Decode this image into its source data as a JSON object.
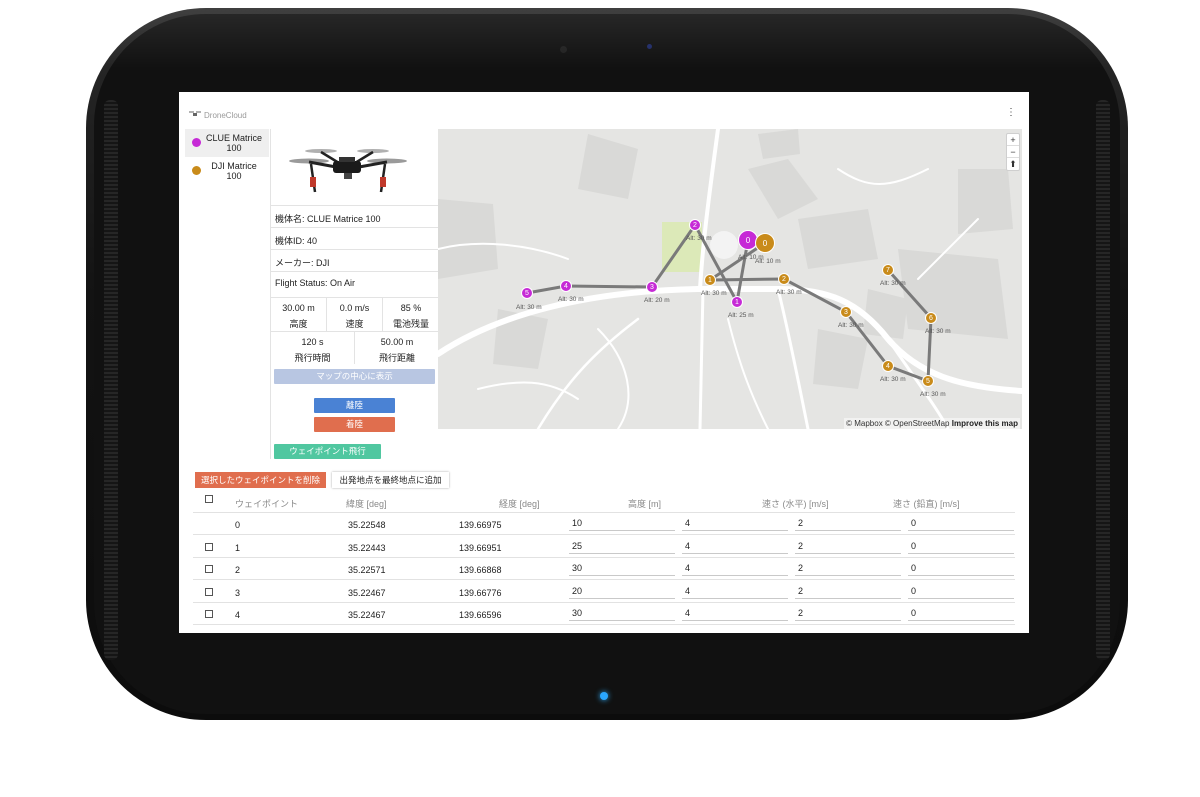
{
  "app": {
    "title": "DroneCloud"
  },
  "drones": [
    {
      "name": "CLUE Matrice 100",
      "color": "#c62ad6",
      "active": true
    },
    {
      "name": "DJI Matrice 100",
      "color": "#c98b1a",
      "active": false
    }
  ],
  "detail": {
    "model_label": "機体名: CLUE Matrice 100",
    "id_label": "機体ID: 40",
    "maker_label": "メーカー: DJI",
    "status_label": "Flight Status: On Air",
    "stats": {
      "altitude": {
        "value": "30.00 m",
        "label": "高度"
      },
      "speed": {
        "value": "0.0 m/s",
        "label": "速度"
      },
      "battery": {
        "value": "85 %",
        "label": "電池残量"
      },
      "flight_time": {
        "value": "120 s",
        "label": "飛行時間"
      },
      "flight_distance": {
        "value": "50.00 m",
        "label": "飛行距離"
      }
    },
    "buttons": {
      "center_map": "マップの中心に表示",
      "takeoff": "離陸",
      "land": "着陸",
      "waypoint_flight": "ウェイポイント飛行"
    }
  },
  "map": {
    "zoom_in": "+",
    "zoom_out": "−",
    "compass": "⬆",
    "attribution_text": "© Mapbox © OpenStreetMap",
    "attribution_link": "Improve this map",
    "route_purple": {
      "color": "#c62ad6",
      "markers": [
        {
          "n": "0",
          "alt": "Alt: 10 m"
        },
        {
          "n": "1",
          "alt": "Alt: 25 m"
        },
        {
          "n": "2",
          "alt": "Alt: 30 m"
        },
        {
          "n": "3",
          "alt": "Alt: 20 m"
        },
        {
          "n": "4",
          "alt": "Alt: 30 m"
        },
        {
          "n": "5",
          "alt": "Alt: 30 m"
        }
      ]
    },
    "route_orange": {
      "color": "#c98b1a",
      "markers": [
        {
          "n": "0",
          "alt": "Alt: 10 m"
        },
        {
          "n": "1",
          "alt": "Alt: 30 m"
        },
        {
          "n": "2",
          "alt": "Alt: 30 m"
        },
        {
          "n": "3",
          "alt": "Alt: 30 m"
        },
        {
          "n": "4",
          "alt": "Alt: 30 m"
        },
        {
          "n": "5",
          "alt": "Alt: 30 m"
        },
        {
          "n": "6",
          "alt": "Alt: 30 m"
        },
        {
          "n": "7",
          "alt": "Alt: 30 m"
        }
      ]
    }
  },
  "waypoints_table": {
    "delete_selected": "選択したウェイポイントを削除",
    "add_start_as_last": "出発地点を最終地点に追加",
    "headers": [
      "ウェイポイント",
      "緯度 [deg]",
      "経度 [deg]",
      "高度 [m]",
      "",
      "速さ (水平) [m/s]",
      "速さ (鉛直) [m/s]"
    ],
    "rows": [
      {
        "wp": "0",
        "lat": "35.22548",
        "lon": "139.66975",
        "alt": "10",
        "col5": "4",
        "hspeed": "2",
        "vspeed": "0",
        "checkbox": false
      },
      {
        "wp": "1",
        "lat": "35.22443",
        "lon": "139.66951",
        "alt": "25",
        "col5": "4",
        "hspeed": "2",
        "vspeed": "0",
        "checkbox": true
      },
      {
        "wp": "2",
        "lat": "35.22571",
        "lon": "139.66868",
        "alt": "30",
        "col5": "4",
        "hspeed": "2",
        "vspeed": "0",
        "checkbox": true
      },
      {
        "wp": "3",
        "lat": "35.22467",
        "lon": "139.66776",
        "alt": "20",
        "col5": "4",
        "hspeed": "2",
        "vspeed": "0",
        "checkbox": true
      },
      {
        "wp": "4",
        "lat": "35.22467",
        "lon": "139.66596",
        "alt": "30",
        "col5": "4",
        "hspeed": "2",
        "vspeed": "0",
        "checkbox": true
      }
    ]
  }
}
